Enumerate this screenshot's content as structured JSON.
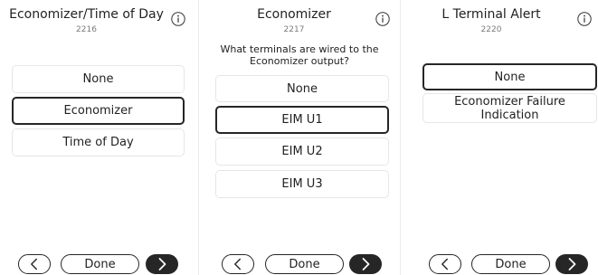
{
  "panels": [
    {
      "title": "Economizer/Time of Day",
      "code": "2216",
      "question": "",
      "options": [
        "None",
        "Economizer",
        "Time of Day"
      ],
      "selected": "Economizer",
      "done_label": "Done",
      "icons": {
        "info": "info-icon",
        "back": "chevron-left-icon",
        "next": "chevron-right-icon"
      }
    },
    {
      "title": "Economizer",
      "code": "2217",
      "question": "What terminals are wired to the Economizer output?",
      "options": [
        "None",
        "EIM U1",
        "EIM U2",
        "EIM U3"
      ],
      "selected": "EIM U1",
      "done_label": "Done",
      "icons": {
        "info": "info-icon",
        "back": "chevron-left-icon",
        "next": "chevron-right-icon"
      }
    },
    {
      "title": "L Terminal Alert",
      "code": "2220",
      "question": "",
      "options": [
        "None",
        "Economizer Failure Indication"
      ],
      "selected": "None",
      "done_label": "Done",
      "icons": {
        "info": "info-icon",
        "back": "chevron-left-icon",
        "next": "chevron-right-icon"
      }
    }
  ],
  "colors": {
    "selected_border": "#262626",
    "option_border": "#e6e6e6",
    "next_button": "#262626"
  }
}
